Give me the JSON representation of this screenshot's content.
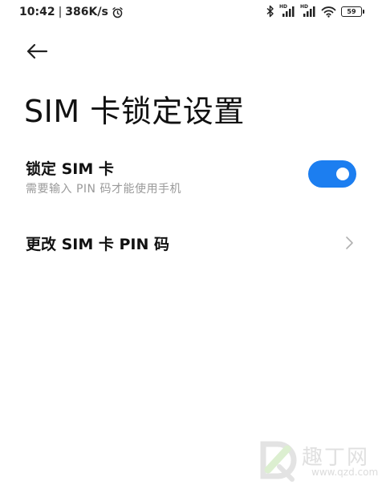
{
  "status_bar": {
    "time": "10:42",
    "separator": "|",
    "net_speed": "386K/s",
    "signal_1_label": "HD",
    "signal_2_label": "HD",
    "battery": "59"
  },
  "header": {
    "title": "SIM 卡锁定设置"
  },
  "settings": {
    "lock_sim": {
      "title": "锁定 SIM 卡",
      "subtitle": "需要输入 PIN 码才能使用手机",
      "enabled": true
    },
    "change_pin": {
      "title": "更改 SIM 卡 PIN 码"
    }
  },
  "watermark": {
    "text": "趣丁网",
    "url": "www.qzd.com"
  },
  "colors": {
    "accent": "#1c7ef0",
    "subtitle": "#9a9a9a",
    "text": "#111111",
    "background": "#ffffff"
  },
  "icons": [
    "alarm-icon",
    "bluetooth-icon",
    "signal-icon",
    "wifi-icon",
    "battery-icon",
    "back-arrow-icon",
    "chevron-right-icon"
  ]
}
